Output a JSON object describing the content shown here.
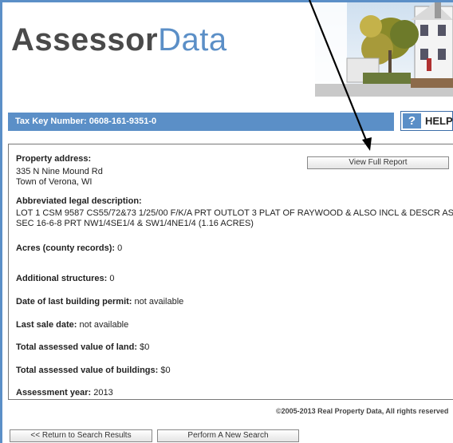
{
  "logo": {
    "part1": "Assessor",
    "part2": "Data"
  },
  "tax_key": "Tax Key Number: 0608-161-9351-0",
  "help": {
    "icon": "?",
    "label": "HELP"
  },
  "property": {
    "address_label": "Property address:",
    "address_line1": "335 N Nine Mound Rd",
    "address_line2": "Town of Verona, WI",
    "view_full_report": "View Full Report",
    "legal_label": "Abbreviated legal description:",
    "legal_line1": "LOT 1 CSM 9587 CS55/72&73 1/25/00 F/K/A PRT OUTLOT 3 PLAT OF RAYWOOD & ALSO INCL & DESCR AS",
    "legal_line2": "SEC 16-6-8 PRT NW1/4SE1/4 & SW1/4NE1/4 (1.16 ACRES)",
    "acres_label": "Acres (county records):",
    "acres_value": " 0",
    "structures_label": "Additional structures:",
    "structures_value": "  0",
    "permit_label": "Date of last building permit:",
    "permit_value": " not available",
    "sale_label": "Last sale date:",
    "sale_value": " not available",
    "land_label": "Total assessed value of land:",
    "land_value": " $0",
    "buildings_label": "Total assessed value of buildings:",
    "buildings_value": " $0",
    "year_label": "Assessment year:",
    "year_value": " 2013"
  },
  "copyright": "©2005-2013 Real Property Data, All rights reserved",
  "buttons": {
    "return": "<< Return to Search Results",
    "new_search": "Perform A New Search"
  },
  "colors": {
    "brand_blue": "#5b8fc7",
    "logo_gray": "#4a4a4a"
  },
  "icons": {
    "help": "question-mark-icon",
    "annotation": "arrow-annotation"
  }
}
